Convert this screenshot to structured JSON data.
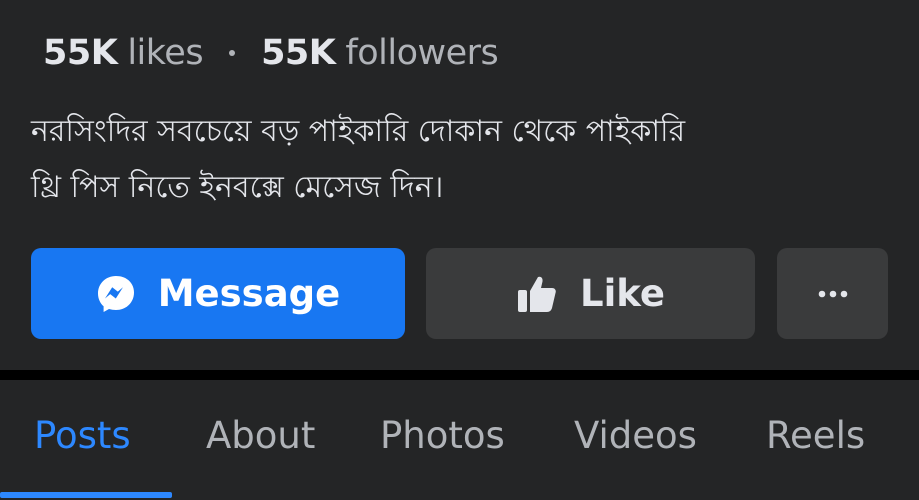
{
  "stats": {
    "likes_count": "55K",
    "likes_word": "likes",
    "followers_count": "55K",
    "followers_word": "followers"
  },
  "bio": {
    "line1": "নরসিংদির সবচেয়ে বড় পাইকারি দোকান থেকে পাইকারি",
    "line2": "থ্রি পিস নিতে ইনবক্সে মেসেজ দিন।"
  },
  "actions": {
    "message_label": "Message",
    "message_icon": "messenger-icon",
    "like_label": "Like",
    "like_icon": "thumbs-up-icon",
    "more_icon": "more-dots-icon"
  },
  "tabs": [
    {
      "label": "Posts",
      "active": true
    },
    {
      "label": "About",
      "active": false
    },
    {
      "label": "Photos",
      "active": false
    },
    {
      "label": "Videos",
      "active": false
    },
    {
      "label": "Reels",
      "active": false
    }
  ],
  "colors": {
    "background": "#242526",
    "primary_button": "#1877f2",
    "secondary_button": "#3a3b3c",
    "active_tab": "#2d88ff",
    "text_primary": "#e4e6eb",
    "text_secondary": "#b0b3b8"
  }
}
